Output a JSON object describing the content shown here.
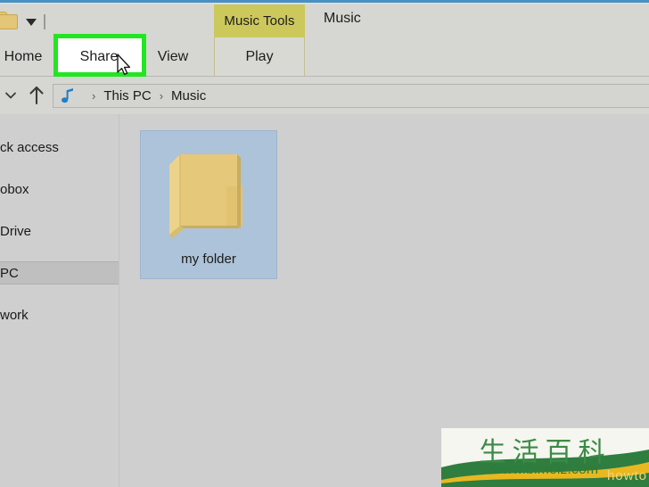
{
  "window": {
    "contextual_tab_group": "Music Tools",
    "title": "Music",
    "quick_access_icons": [
      "folder-icon",
      "chevron-down-icon"
    ]
  },
  "ribbon": {
    "tabs": [
      {
        "label": "Home",
        "selected": false,
        "highlighted": false
      },
      {
        "label": "Share",
        "selected": false,
        "highlighted": true
      },
      {
        "label": "View",
        "selected": false,
        "highlighted": false
      },
      {
        "label": "Play",
        "selected": false,
        "highlighted": false,
        "group": "Music Tools"
      }
    ],
    "highlight_color": "#22e621"
  },
  "navbar": {
    "recent_locations_icon": "chevron-down-icon",
    "up_icon": "arrow-up-icon",
    "path_icon": "music-note-icon",
    "breadcrumbs": [
      "This PC",
      "Music"
    ],
    "separator": "›"
  },
  "sidebar": {
    "items": [
      {
        "label": "ck access",
        "selected": false
      },
      {
        "label": "obox",
        "selected": false
      },
      {
        "label": "Drive",
        "selected": false
      },
      {
        "label": "PC",
        "selected": true
      },
      {
        "label": "work",
        "selected": false
      }
    ]
  },
  "content": {
    "items": [
      {
        "name": "my folder",
        "type": "folder",
        "selected": true
      }
    ]
  },
  "watermark": {
    "chinese": "生活百科",
    "url": "www.bimeiz.com",
    "howto": "howto"
  },
  "colors": {
    "window_bg": "#cfcfcf",
    "chrome_bg": "#d6d6d3",
    "contextual_tab": "#ccc85c",
    "selection": "#adc3d9",
    "folder": "#e3c677",
    "accent_border": "#4a90c4",
    "highlight": "#22e621"
  }
}
